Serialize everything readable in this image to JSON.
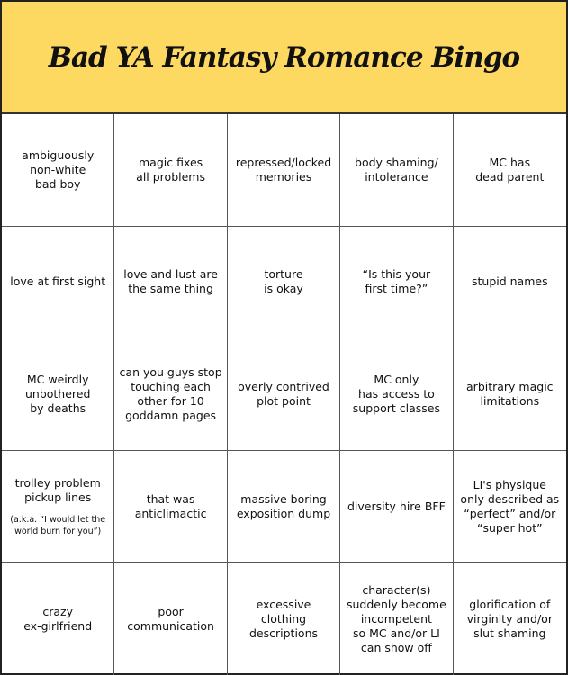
{
  "title": "Bad YA Fantasy Romance Bingo",
  "colors": {
    "header_bg": "#fdd962",
    "border": "#333333"
  },
  "cells": [
    {
      "lines": [
        "ambiguously",
        "non-white",
        "bad boy"
      ]
    },
    {
      "lines": [
        "magic fixes",
        "all problems"
      ]
    },
    {
      "lines": [
        "repressed/locked",
        "memories"
      ]
    },
    {
      "lines": [
        "body shaming/",
        "intolerance"
      ]
    },
    {
      "lines": [
        "MC has",
        "dead parent"
      ]
    },
    {
      "lines": [
        "love at first sight"
      ]
    },
    {
      "lines": [
        "love and lust are",
        "the same thing"
      ]
    },
    {
      "lines": [
        "torture",
        "is okay"
      ]
    },
    {
      "lines": [
        "“Is this your",
        "first time?”"
      ]
    },
    {
      "lines": [
        "stupid names"
      ]
    },
    {
      "lines": [
        "MC weirdly",
        "unbothered",
        "by deaths"
      ]
    },
    {
      "lines": [
        "can you guys stop",
        "touching each",
        "other for 10",
        "goddamn pages"
      ]
    },
    {
      "lines": [
        "overly contrived",
        "plot point"
      ]
    },
    {
      "lines": [
        "MC only",
        "has access to",
        "support classes"
      ]
    },
    {
      "lines": [
        "arbitrary magic",
        "limitations"
      ]
    },
    {
      "lines": [
        "trolley problem",
        "pickup lines"
      ],
      "note": [
        "(a.k.a. “I would let the",
        "world burn for you”)"
      ]
    },
    {
      "lines": [
        "that was",
        "anticlimactic"
      ]
    },
    {
      "lines": [
        "massive boring",
        "exposition dump"
      ]
    },
    {
      "lines": [
        "diversity hire BFF"
      ]
    },
    {
      "lines": [
        "LI's physique",
        "only described as",
        "“perfect” and/or",
        "“super hot”"
      ]
    },
    {
      "lines": [
        "crazy",
        "ex-girlfriend"
      ]
    },
    {
      "lines": [
        "poor",
        "communication"
      ]
    },
    {
      "lines": [
        "excessive",
        "clothing",
        "descriptions"
      ]
    },
    {
      "lines": [
        "character(s)",
        "suddenly become",
        "incompetent",
        "so MC and/or LI",
        "can show off"
      ]
    },
    {
      "lines": [
        "glorification of",
        "virginity and/or",
        "slut shaming"
      ]
    }
  ]
}
